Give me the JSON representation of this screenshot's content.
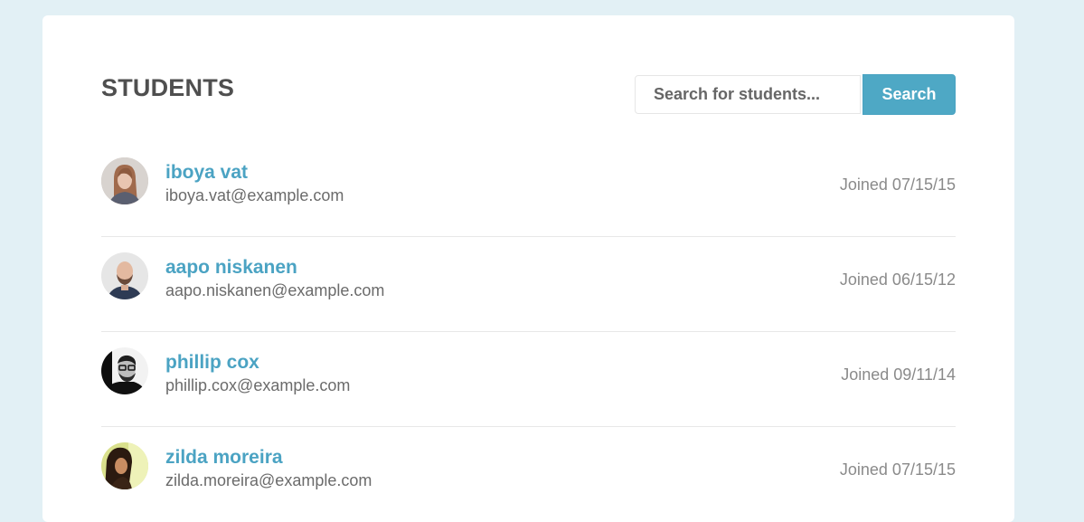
{
  "page": {
    "title": "STUDENTS"
  },
  "search": {
    "placeholder": "Search for students...",
    "button_label": "Search"
  },
  "students": [
    {
      "name": "iboya vat",
      "email": "iboya.vat@example.com",
      "joined": "Joined 07/15/15",
      "avatar_icon": "user-avatar-photo"
    },
    {
      "name": "aapo niskanen",
      "email": "aapo.niskanen@example.com",
      "joined": "Joined 06/15/12",
      "avatar_icon": "user-avatar-photo"
    },
    {
      "name": "phillip cox",
      "email": "phillip.cox@example.com",
      "joined": "Joined 09/11/14",
      "avatar_icon": "user-avatar-photo"
    },
    {
      "name": "zilda moreira",
      "email": "zilda.moreira@example.com",
      "joined": "Joined 07/15/15",
      "avatar_icon": "user-avatar-photo"
    }
  ],
  "colors": {
    "background": "#e2f0f5",
    "accent": "#4ea8c5",
    "name_link": "#4ba3c3",
    "title_text": "#4f4f4f",
    "email_text": "#6b6b6b",
    "joined_text": "#8a8a8a"
  }
}
